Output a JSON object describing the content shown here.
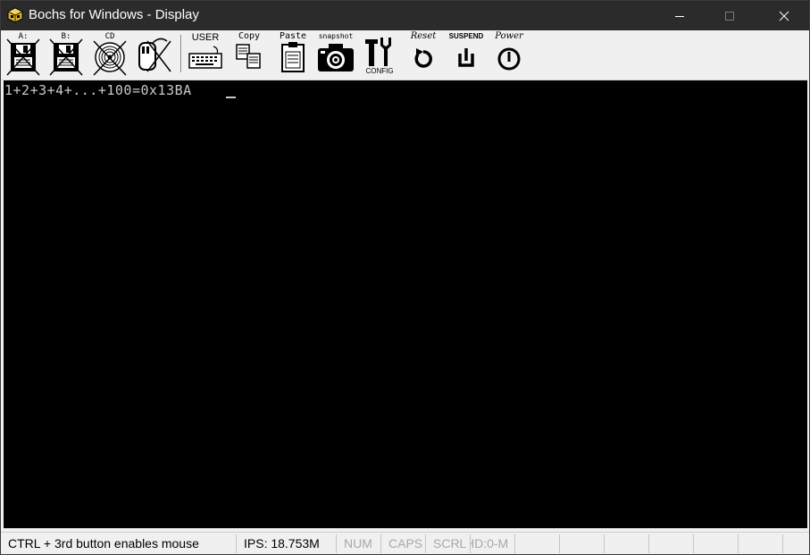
{
  "window": {
    "title": "Bochs for Windows - Display"
  },
  "toolbar": {
    "floppy_a_label": "A:",
    "floppy_b_label": "B:",
    "cdrom_label": "CD",
    "user_label": "USER",
    "copy_label": "Copy",
    "paste_label": "Paste",
    "snapshot_label": "snapshot",
    "config_label": "CONFIG",
    "reset_label": "Reset",
    "suspend_label": "SUSPEND",
    "power_label": "Power"
  },
  "screen": {
    "line1": "1+2+3+4+...+100=0x13BA"
  },
  "statusbar": {
    "mouse_hint": "CTRL + 3rd button enables mouse",
    "ips": "IPS: 18.753M",
    "num": "NUM",
    "caps": "CAPS",
    "scrl": "SCRL",
    "hd": "HD:0-M"
  },
  "colors": {
    "titlebar_bg": "#2b2b2b",
    "screen_bg": "#000000",
    "screen_fg": "#c8c8c8",
    "toolbar_bg": "#f0f0f0"
  }
}
